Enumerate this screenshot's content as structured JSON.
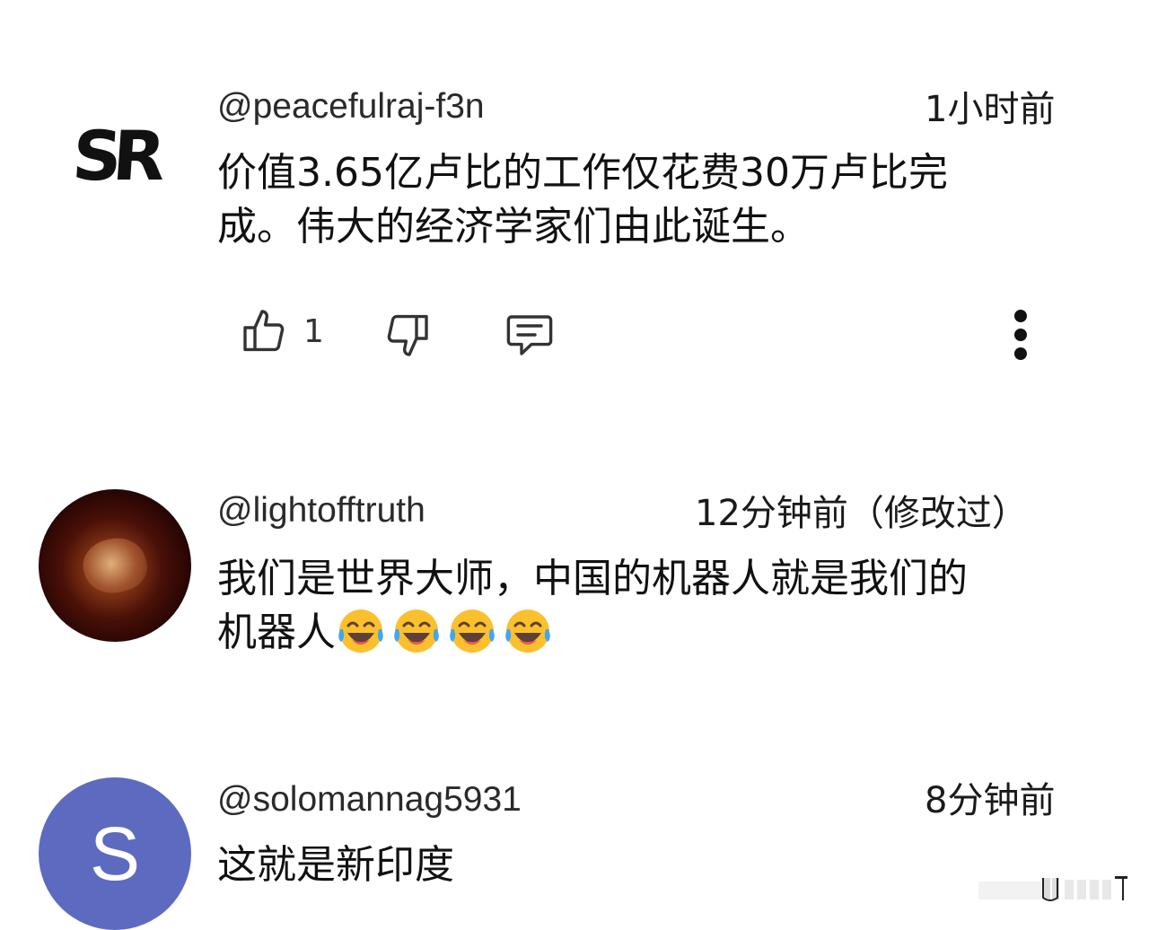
{
  "comments": [
    {
      "avatar": {
        "type": "logo",
        "text": "SR"
      },
      "handle": "@peacefulraj-f3n",
      "time": "1小时前",
      "lines": [
        "价值3.65亿卢比的工作仅花费30万卢比完",
        "成。伟大的经济学家们由此诞生。"
      ],
      "likes": "1",
      "icons": [
        "thumb-up-icon",
        "thumb-down-icon",
        "reply-icon",
        "more-vertical-icon"
      ]
    },
    {
      "avatar": {
        "type": "photo"
      },
      "handle": "@lightofftruth",
      "time": "12分钟前（修改过）",
      "lines": [
        "我们是世界大师，中国的机器人就是我们的",
        "机器人"
      ],
      "emoji": [
        "face-with-tears-of-joy",
        "face-with-tears-of-joy",
        "face-with-tears-of-joy",
        "face-with-tears-of-joy"
      ]
    },
    {
      "avatar": {
        "type": "letter",
        "text": "S",
        "color": "#5c6bc0"
      },
      "handle": "@solomannag5931",
      "time": "8分钟前",
      "lines": [
        "这就是新印度"
      ]
    }
  ],
  "colors": {
    "background": "#ffffff",
    "text": "#111111",
    "avatar_letter_bg": "#5c6bc0"
  }
}
